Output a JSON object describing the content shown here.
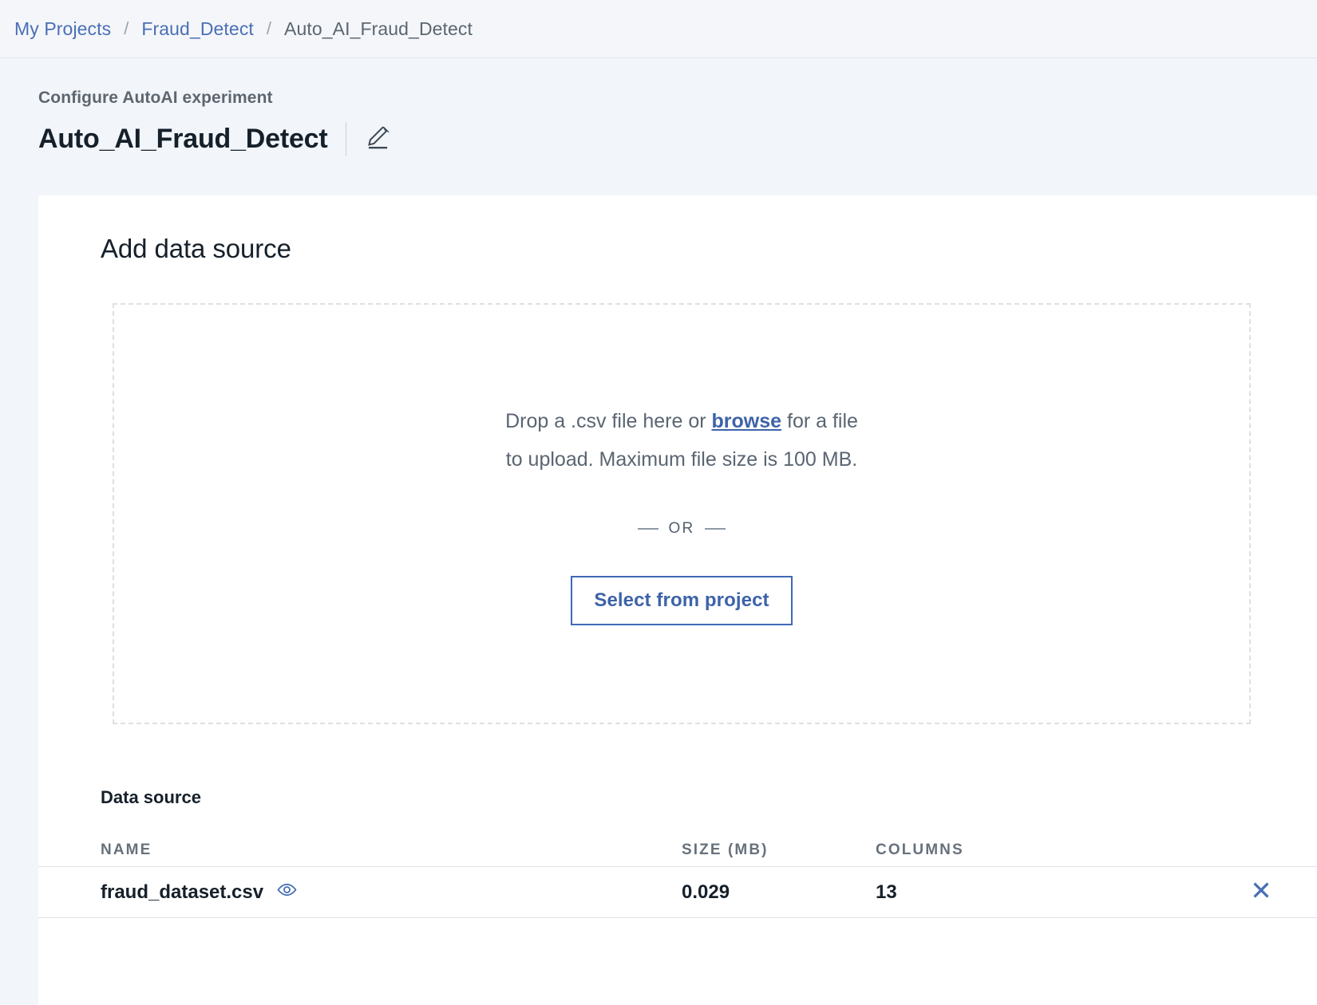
{
  "breadcrumb": {
    "items": [
      {
        "label": "My Projects",
        "current": false
      },
      {
        "label": "Fraud_Detect",
        "current": false
      },
      {
        "label": "Auto_AI_Fraud_Detect",
        "current": true
      }
    ],
    "separator": "/"
  },
  "header": {
    "eyebrow": "Configure AutoAI experiment",
    "title": "Auto_AI_Fraud_Detect",
    "edit_icon": "pencil-icon"
  },
  "card": {
    "title": "Add data source"
  },
  "dropzone": {
    "line1_before": "Drop a .csv file here or ",
    "link": "browse",
    "line1_after": " for a file",
    "line2": "to upload. Maximum file size is 100 MB.",
    "or_label": "OR",
    "select_button": "Select from project"
  },
  "data_source": {
    "heading": "Data source",
    "columns": [
      "NAME",
      "SIZE (MB)",
      "COLUMNS"
    ],
    "rows": [
      {
        "name": "fraud_dataset.csv",
        "size": "0.029",
        "columns": "13",
        "preview_icon": "eye-icon",
        "remove_icon": "close-icon"
      }
    ]
  },
  "colors": {
    "link": "#3d63a8",
    "accent": "#4a6fb5",
    "page_bg": "#f2f5f9",
    "card_bg": "#ffffff",
    "text": "#16202a"
  }
}
